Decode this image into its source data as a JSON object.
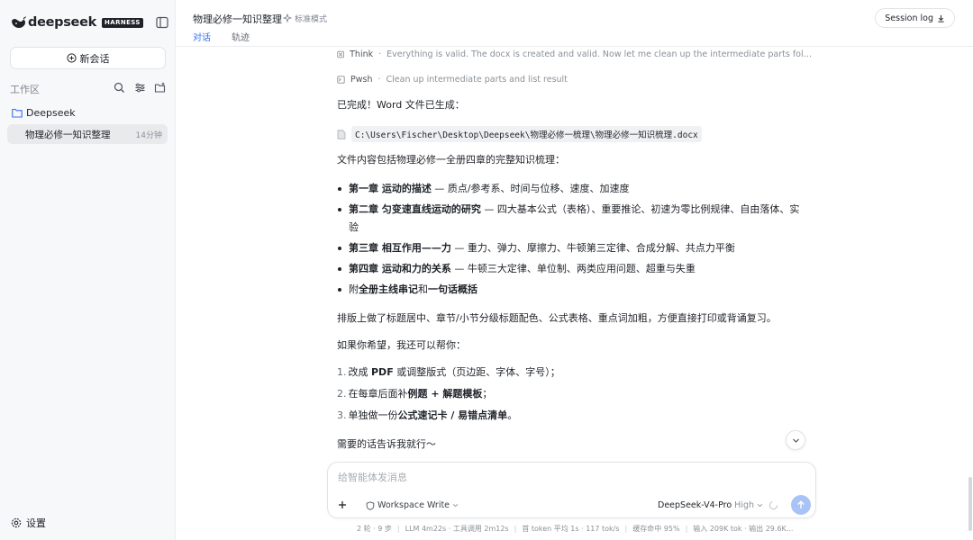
{
  "sidebar": {
    "brand": "deepseek",
    "badge": "HARNESS",
    "new_chat_label": "新会话",
    "workspace_label": "工作区",
    "folder_name": "Deepseek",
    "sessions": [
      {
        "title": "物理必修一知识整理",
        "time": "14分钟"
      }
    ],
    "settings_label": "设置"
  },
  "header": {
    "title": "物理必修一知识整理",
    "mode": "标准模式",
    "tabs": [
      {
        "label": "对话",
        "active": true
      },
      {
        "label": "轨迹",
        "active": false
      }
    ],
    "session_log_label": "Session log"
  },
  "messages": {
    "tool_steps": [
      {
        "name": "Think",
        "desc": "Everything is valid. The docx is created and valid. Now let me clean up the intermediate parts folder to keep..."
      },
      {
        "name": "Pwsh",
        "desc": "Clean up intermediate parts and list result"
      }
    ],
    "done_line": "已完成！Word 文件已生成：",
    "file_path": "C:\\Users\\Fischer\\Desktop\\Deepseek\\物理必修一梳理\\物理必修一知识梳理.docx",
    "summary_intro": "文件内容包括物理必修一全册四章的完整知识梳理：",
    "chapters": [
      {
        "bold": "第一章 运动的描述",
        "rest": " — 质点/参考系、时间与位移、速度、加速度"
      },
      {
        "bold": "第二章 匀变速直线运动的研究",
        "rest": " — 四大基本公式（表格）、重要推论、初速为零比例规律、自由落体、实验"
      },
      {
        "bold": "第三章 相互作用——力",
        "rest": " — 重力、弹力、摩擦力、牛顿第三定律、合成分解、共点力平衡"
      },
      {
        "bold": "第四章 运动和力的关系",
        "rest": " — 牛顿三大定律、单位制、两类应用问题、超重与失重"
      }
    ],
    "appendix_pre": "附",
    "appendix_bold1": "全册主线串记",
    "appendix_mid": "和",
    "appendix_bold2": "一句话概括",
    "layout_note": "排版上做了标题居中、章节/小节分级标题配色、公式表格、重点词加粗，方便直接打印或背诵复习。",
    "offer_intro": "如果你希望，我还可以帮你：",
    "offers": [
      {
        "num": "1.",
        "pre": "改成 ",
        "bold": "PDF",
        "post": " 或调整版式（页边距、字体、字号）；"
      },
      {
        "num": "2.",
        "pre": "在每章后面补",
        "bold": "例题 + 解题模板",
        "post": "；"
      },
      {
        "num": "3.",
        "pre": "单独做一份",
        "bold": "公式速记卡 / 易错点清单",
        "post": "。"
      }
    ],
    "closing": "需要的话告诉我就行～"
  },
  "composer": {
    "placeholder": "给智能体发消息",
    "workspace_mode": "Workspace Write",
    "model": "DeepSeek-V4-Pro",
    "level": "High"
  },
  "footer": {
    "stats": [
      "2 轮 · 9 步",
      "LLM 4m22s · 工具调用 2m12s",
      "首 token 平均 1s · 117 tok/s",
      "缓存命中 95%",
      "输入 209K tok · 输出 29.6K..."
    ]
  },
  "colors": {
    "accent": "#3a6ff0",
    "send_button": "#a8c3f5",
    "sidebar_bg": "#f7f8fa",
    "active_item_bg": "#e9eaec"
  }
}
